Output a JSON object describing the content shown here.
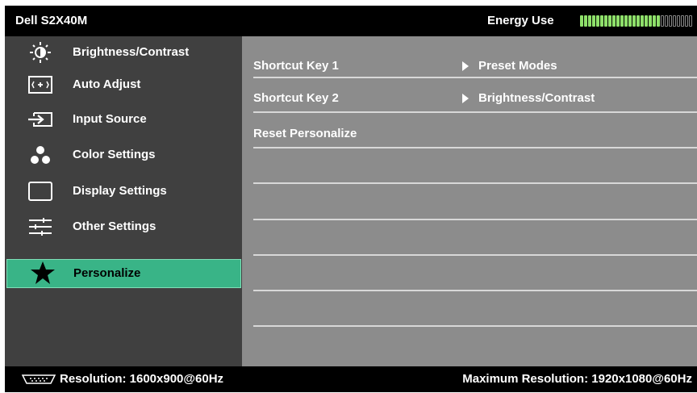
{
  "header": {
    "model": "Dell S2X40M",
    "energy_label": "Energy Use",
    "energy_level": 0.7
  },
  "menu": {
    "items": [
      {
        "label": "Brightness/Contrast",
        "icon": "brightness-icon"
      },
      {
        "label": "Auto Adjust",
        "icon": "auto-adjust-icon"
      },
      {
        "label": "Input Source",
        "icon": "input-source-icon"
      },
      {
        "label": "Color Settings",
        "icon": "color-settings-icon"
      },
      {
        "label": "Display Settings",
        "icon": "display-settings-icon"
      },
      {
        "label": "Other Settings",
        "icon": "other-settings-icon"
      },
      {
        "label": "Personalize",
        "icon": "star-icon",
        "selected": true
      }
    ]
  },
  "panel": {
    "rows": [
      {
        "label": "Shortcut Key 1",
        "value": "Preset Modes"
      },
      {
        "label": "Shortcut Key 2",
        "value": "Brightness/Contrast"
      },
      {
        "label": "Reset Personalize",
        "value": ""
      }
    ]
  },
  "footer": {
    "resolution": "Resolution: 1600x900@60Hz",
    "max_resolution": "Maximum Resolution: 1920x1080@60Hz",
    "connector_icon": "vga-connector-icon"
  },
  "colors": {
    "selected": "#39b487",
    "energy_on": "#8ee06a",
    "left_bg": "#404040",
    "right_bg": "#8c8c8c"
  }
}
